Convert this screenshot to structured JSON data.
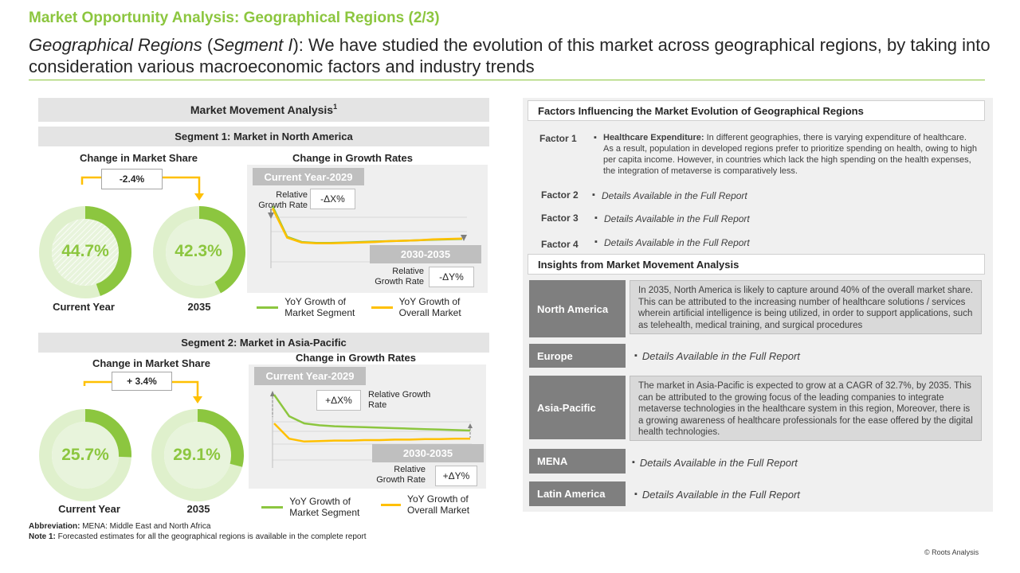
{
  "header": {
    "title": "Market Opportunity Analysis: Geographical Regions (2/3)",
    "subtitle_italic": "Geographical Regions",
    "subtitle_paren_open": " (",
    "subtitle_segment": "Segment I",
    "subtitle_rest": "): We have studied the evolution of this market across geographical regions, by taking into consideration various macroeconomic factors and industry trends"
  },
  "left": {
    "panel_title": "Market Movement Analysis",
    "panel_title_sup": "1",
    "segments": [
      {
        "band": "Segment 1: Market in North America",
        "share_head": "Change in Market Share",
        "growth_head": "Change in Growth Rates",
        "change": "-2.4%",
        "current_value": "44.7%",
        "future_value": "42.3%",
        "current_label": "Current Year",
        "future_label": "2035",
        "period1": "Current Year-2029",
        "period2": "2030-2035",
        "rel1": "Relative Growth Rate",
        "delta1": "-ΔX%",
        "rel2": "Relative Growth Rate",
        "delta2": "-ΔY%",
        "legend_segment": "YoY Growth of Market Segment",
        "legend_overall": "YoY Growth of Overall Market"
      },
      {
        "band": "Segment 2: Market in Asia-Pacific",
        "share_head": "Change in Market Share",
        "growth_head": "Change in Growth Rates",
        "change": "+ 3.4%",
        "current_value": "25.7%",
        "future_value": "29.1%",
        "current_label": "Current Year",
        "future_label": "2035",
        "period1": "Current Year-2029",
        "period2": "2030-2035",
        "rel1": "Relative Growth Rate",
        "delta1": "+ΔX%",
        "rel2": "Relative Growth Rate",
        "delta2": "+ΔY%",
        "legend_segment": "YoY Growth of Market Segment",
        "legend_overall": "YoY Growth of Overall Market"
      }
    ],
    "abbrev_label": "Abbreviation:",
    "abbrev_text": " MENA: Middle East and North Africa",
    "note_label": "Note 1:",
    "note_text": " Forecasted estimates for all the geographical regions is available in the complete report"
  },
  "right": {
    "factors_title": "Factors Influencing the Market Evolution of Geographical Regions",
    "factors": [
      {
        "label": "Factor 1",
        "bold": "Healthcare Expenditure:",
        "text": " In different geographies, there is varying expenditure of healthcare. As a result, population in developed regions prefer to prioritize spending on health, owing to high per capita income. However, in countries which lack the high spending on the health expenses, the integration of metaverse is comparatively less."
      },
      {
        "label": "Factor 2",
        "text": "Details Available in the Full Report"
      },
      {
        "label": "Factor 3",
        "text": "Details Available in the Full Report"
      },
      {
        "label": "Factor 4",
        "text": "Details Available in the Full Report"
      }
    ],
    "insights_title": "Insights from Market Movement Analysis",
    "regions": [
      {
        "name": "North America",
        "text": "In 2035, North America is likely to capture around 40% of the overall market share. This can be attributed to the increasing number of healthcare solutions / services wherein artificial intelligence is being utilized, in order to support applications, such as telehealth, medical training, and surgical procedures"
      },
      {
        "name": "Europe",
        "text": "Details Available in the Full Report"
      },
      {
        "name": "Asia-Pacific",
        "text": "The market in Asia-Pacific is expected to grow at a CAGR of 32.7%, by 2035. This can be attributed to the growing focus of the leading companies to integrate metaverse technologies in the healthcare system in this region, Moreover, there is a growing awareness of healthcare professionals for the ease offered by the digital health technologies."
      },
      {
        "name": "MENA",
        "text": "Details Available in the Full Report"
      },
      {
        "name": "Latin America",
        "text": "Details Available in the Full Report"
      }
    ],
    "copyright": "© Roots Analysis"
  },
  "colors": {
    "accent_green": "#8cc63f",
    "overall_yellow": "#ffc000",
    "donut_light": "#dff0cc",
    "region_gray": "#7f7f7f"
  },
  "chart_data": [
    {
      "type": "pie",
      "title": "Current Year",
      "categories": [
        "North America",
        "Rest of market"
      ],
      "values": [
        44.7,
        55.3
      ]
    },
    {
      "type": "pie",
      "title": "2035",
      "categories": [
        "North America",
        "Rest of market"
      ],
      "values": [
        42.3,
        57.7
      ]
    },
    {
      "type": "pie",
      "title": "Current Year",
      "categories": [
        "Asia-Pacific",
        "Rest of market"
      ],
      "values": [
        25.7,
        74.3
      ]
    },
    {
      "type": "pie",
      "title": "2035",
      "categories": [
        "Asia-Pacific",
        "Rest of market"
      ],
      "values": [
        29.1,
        70.9
      ]
    },
    {
      "type": "line",
      "title": "Change in Growth Rates",
      "series": [
        {
          "name": "YoY Growth of Market Segment",
          "values": [
            100,
            30,
            18,
            16,
            16,
            17,
            18,
            19,
            20,
            21,
            22,
            23,
            24,
            25
          ]
        },
        {
          "name": "YoY Growth of Overall Market",
          "values": [
            95,
            28,
            17,
            15,
            15,
            16,
            17,
            18,
            20,
            21,
            22,
            24,
            25,
            26
          ]
        }
      ]
    },
    {
      "type": "line",
      "title": "Change in Growth Rates",
      "series": [
        {
          "name": "YoY Growth of Market Segment",
          "values": [
            100,
            55,
            40,
            36,
            34,
            33,
            32,
            31,
            30,
            29,
            28,
            27,
            26,
            25
          ]
        },
        {
          "name": "YoY Growth of Overall Market",
          "values": [
            40,
            8,
            2,
            3,
            4,
            4,
            5,
            5,
            6,
            6,
            7,
            7,
            8,
            8
          ]
        }
      ]
    }
  ]
}
